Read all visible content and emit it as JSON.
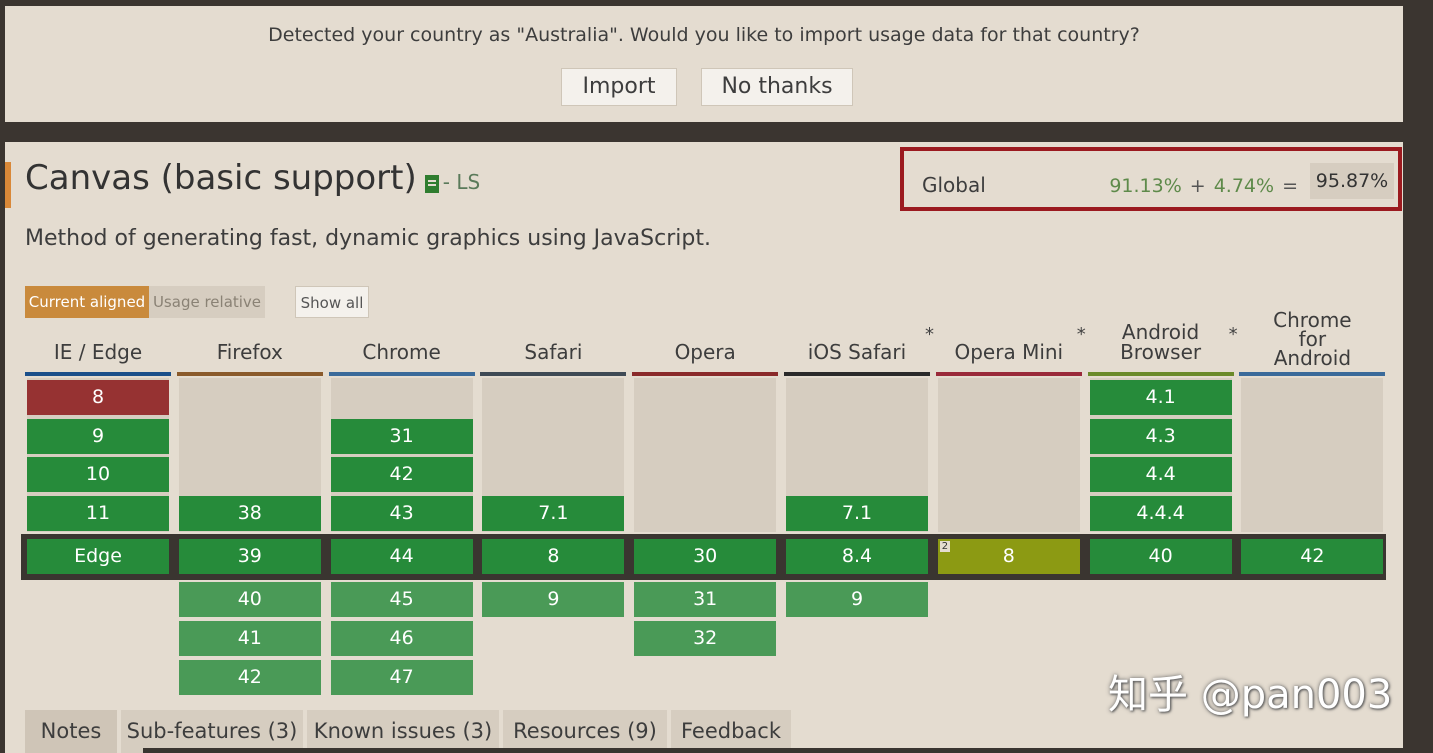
{
  "banner": {
    "message": "Detected your country as \"Australia\". Would you like to import usage data for that country?",
    "import_label": "Import",
    "no_thanks_label": "No thanks"
  },
  "feature": {
    "title": "Canvas (basic support)",
    "spec_status": "- LS",
    "description": "Method of generating fast, dynamic graphics using JavaScript."
  },
  "global": {
    "label": "Global",
    "supported": "91.13%",
    "plus": "+",
    "partial": "4.74%",
    "equals": "=",
    "total": "95.87%"
  },
  "toggles": {
    "current_aligned": "Current aligned",
    "usage_relative": "Usage relative",
    "show_all": "Show all"
  },
  "browsers": [
    {
      "name": "IE / Edge",
      "bar_color": "#1a4f8a",
      "star": ""
    },
    {
      "name": "Firefox",
      "bar_color": "#8a5a2b",
      "star": ""
    },
    {
      "name": "Chrome",
      "bar_color": "#3a6a9a",
      "star": ""
    },
    {
      "name": "Safari",
      "bar_color": "#3f4a55",
      "star": ""
    },
    {
      "name": "Opera",
      "bar_color": "#8a2a2a",
      "star": ""
    },
    {
      "name": "iOS Safari",
      "bar_color": "#2a2a2a",
      "star": "*"
    },
    {
      "name": "Opera Mini",
      "bar_color": "#9a2a3a",
      "star": "*"
    },
    {
      "name": "Android Browser",
      "bar_color": "#6a8a2a",
      "star": "*"
    },
    {
      "name": "Chrome for Android",
      "bar_color": "#3a6a9a",
      "star": ""
    }
  ],
  "versions": {
    "past": [
      [
        {
          "v": "8",
          "s": "n"
        },
        {
          "v": "9",
          "s": "y"
        },
        {
          "v": "10",
          "s": "y"
        },
        {
          "v": "11",
          "s": "y"
        }
      ],
      [
        {
          "v": "38",
          "s": "y"
        }
      ],
      [
        {
          "v": "31",
          "s": "y"
        },
        {
          "v": "42",
          "s": "y"
        },
        {
          "v": "43",
          "s": "y"
        }
      ],
      [
        {
          "v": "7.1",
          "s": "y"
        }
      ],
      [],
      [
        {
          "v": "7.1",
          "s": "y"
        }
      ],
      [],
      [
        {
          "v": "4.1",
          "s": "y"
        },
        {
          "v": "4.3",
          "s": "y"
        },
        {
          "v": "4.4",
          "s": "y"
        },
        {
          "v": "4.4.4",
          "s": "y"
        }
      ],
      []
    ],
    "current": [
      {
        "v": "Edge",
        "s": "y"
      },
      {
        "v": "39",
        "s": "y"
      },
      {
        "v": "44",
        "s": "y"
      },
      {
        "v": "8",
        "s": "y"
      },
      {
        "v": "30",
        "s": "y"
      },
      {
        "v": "8.4",
        "s": "y"
      },
      {
        "v": "8",
        "s": "p",
        "note": "2"
      },
      {
        "v": "40",
        "s": "y"
      },
      {
        "v": "42",
        "s": "y"
      }
    ],
    "future": [
      [],
      [
        {
          "v": "40",
          "s": "f"
        },
        {
          "v": "41",
          "s": "f"
        },
        {
          "v": "42",
          "s": "f"
        }
      ],
      [
        {
          "v": "45",
          "s": "f"
        },
        {
          "v": "46",
          "s": "f"
        },
        {
          "v": "47",
          "s": "f"
        }
      ],
      [
        {
          "v": "9",
          "s": "f"
        }
      ],
      [
        {
          "v": "31",
          "s": "f"
        },
        {
          "v": "32",
          "s": "f"
        }
      ],
      [
        {
          "v": "9",
          "s": "f"
        }
      ],
      [],
      [],
      []
    ]
  },
  "tabs": [
    "Notes",
    "Sub-features (3)",
    "Known issues (3)",
    "Resources (9)",
    "Feedback"
  ],
  "watermark": "知乎 @pan003",
  "colors": {
    "supported": "#268b3a",
    "unsupported": "#963232",
    "partial": "#8c9a13",
    "highlight_border": "#9b1a1f"
  }
}
